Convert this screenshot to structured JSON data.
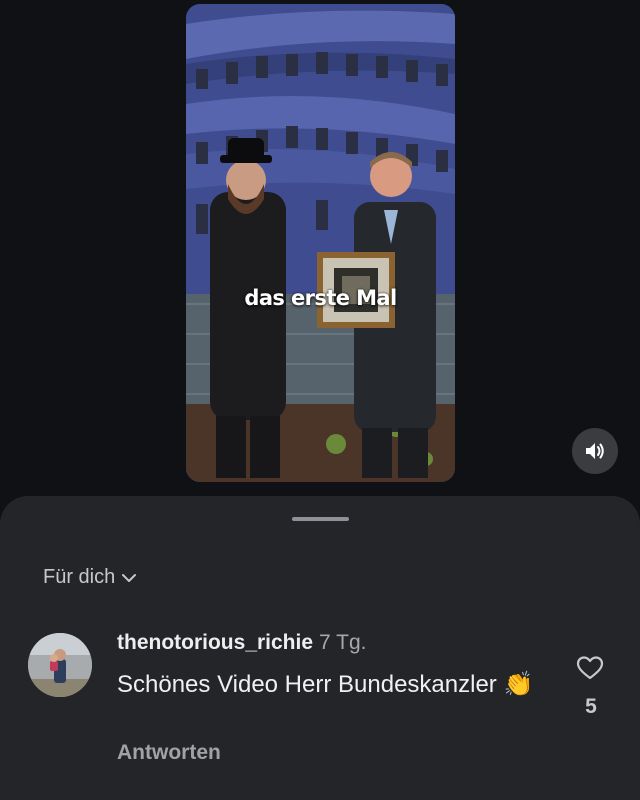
{
  "video": {
    "caption": "das erste Mal",
    "sound_icon": "volume-icon"
  },
  "sheet": {
    "filter_label": "Für dich",
    "filter_icon": "chevron-down-icon"
  },
  "comment": {
    "username": "thenotorious_richie",
    "time": "7 Tg.",
    "text": "Schönes Video Herr Bundeskanzler",
    "emoji": "👏",
    "reply_label": "Antworten",
    "like_count": "5",
    "like_icon": "heart-icon"
  }
}
